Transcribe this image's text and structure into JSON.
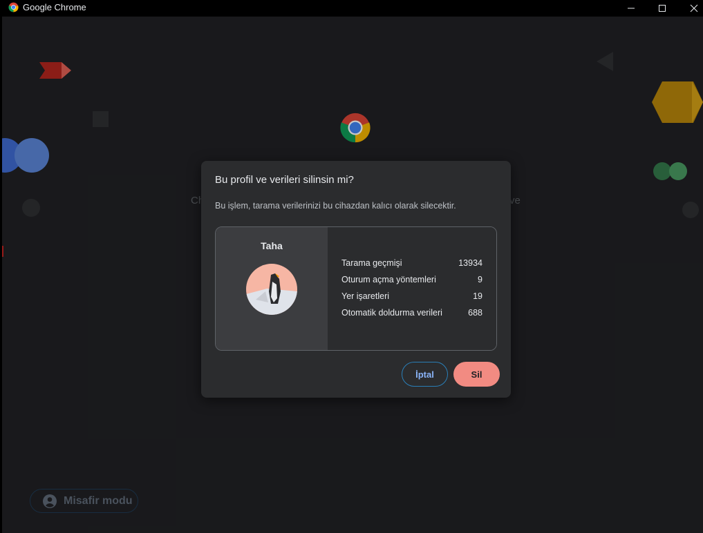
{
  "window": {
    "title": "Google Chrome"
  },
  "background": {
    "text_left": "Ch",
    "text_right": "ve",
    "guest_button": "Misafir modu"
  },
  "dialog": {
    "title": "Bu profil ve verileri silinsin mi?",
    "description": "Bu işlem, tarama verilerinizi bu cihazdan kalıcı olarak silecektir.",
    "profile": {
      "name": "Taha"
    },
    "stats": [
      {
        "label": "Tarama geçmişi",
        "value": "13934"
      },
      {
        "label": "Oturum açma yöntemleri",
        "value": "9"
      },
      {
        "label": "Yer işaretleri",
        "value": "19"
      },
      {
        "label": "Otomatik doldurma verileri",
        "value": "688"
      }
    ],
    "cancel_label": "İptal",
    "delete_label": "Sil"
  },
  "colors": {
    "accent_blue": "#8ab4f8",
    "danger": "#f28b82",
    "surface": "#2b2c2e"
  }
}
